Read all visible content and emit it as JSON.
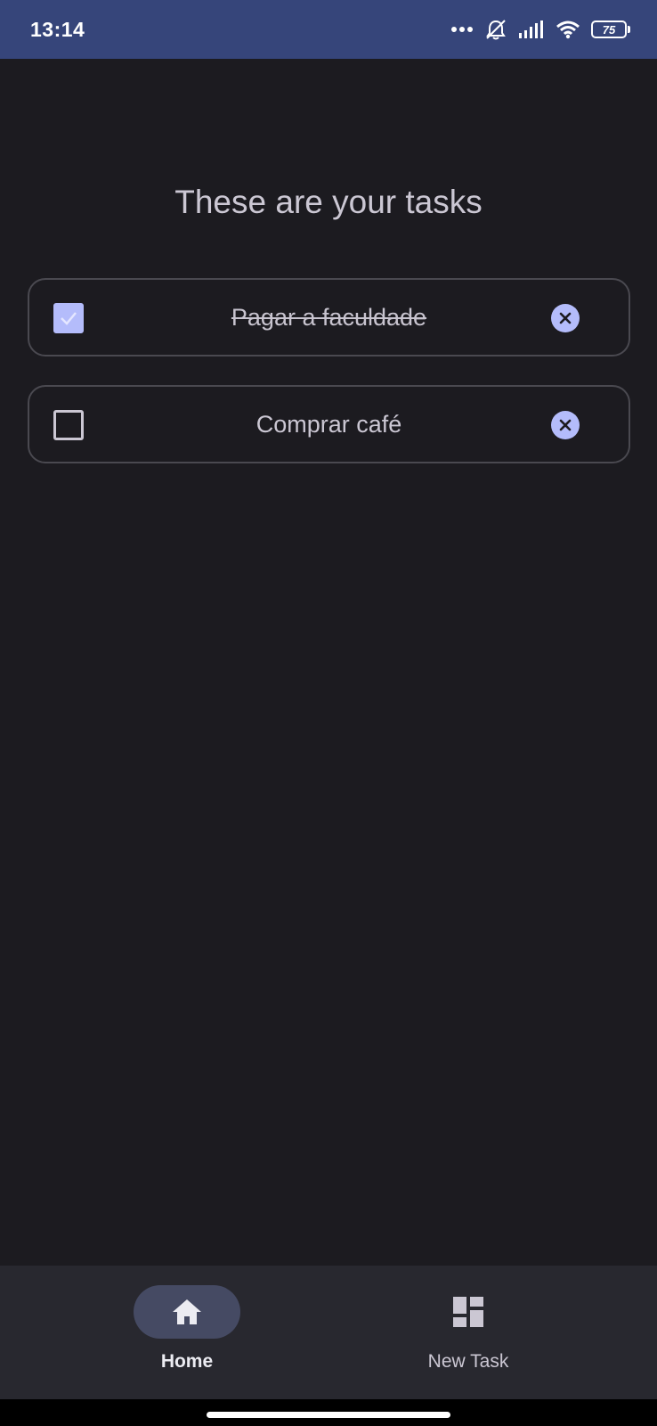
{
  "status_bar": {
    "time": "13:14",
    "battery_level": "75",
    "icons": [
      "more-dots-icon",
      "alarm-off-icon",
      "signal-icon",
      "wifi-icon",
      "battery-icon"
    ]
  },
  "page": {
    "title": "These are your tasks"
  },
  "tasks": [
    {
      "label": "Pagar a faculdade",
      "checked": true
    },
    {
      "label": "Comprar café",
      "checked": false
    }
  ],
  "bottom_nav": {
    "items": [
      {
        "label": "Home",
        "icon": "home-icon",
        "selected": true
      },
      {
        "label": "New Task",
        "icon": "dashboard-icon",
        "selected": false
      }
    ]
  },
  "colors": {
    "status_bar": "#36457a",
    "background": "#1c1b20",
    "accent": "#b4bcfb",
    "nav_background": "#28282f",
    "nav_selected_pill": "#454a63",
    "text": "#cbc7d3"
  }
}
